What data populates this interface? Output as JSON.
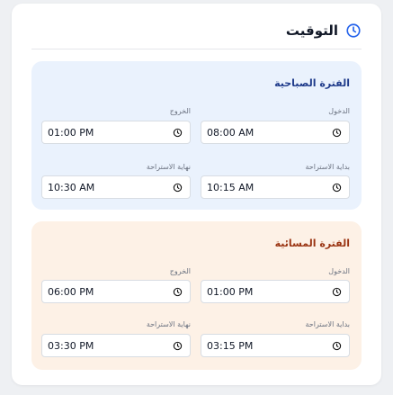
{
  "header": {
    "title": "التوقيت",
    "icon": "clock-icon"
  },
  "colors": {
    "accent": "#2563eb",
    "morning_bg": "#eaf2fd",
    "evening_bg": "#fdf1e6"
  },
  "morning": {
    "title": "الفترة الصباحية",
    "check_in_label": "الدخول",
    "check_in_value": "08:00 AM",
    "check_out_label": "الخروج",
    "check_out_value": "01:00 PM",
    "break_start_label": "بداية الاستراحة",
    "break_start_value": "10:15 AM",
    "break_end_label": "نهاية الاستراحة",
    "break_end_value": "10:30 AM"
  },
  "evening": {
    "title": "الفترة المسائية",
    "check_in_label": "الدخول",
    "check_in_value": "01:00 PM",
    "check_out_label": "الخروج",
    "check_out_value": "06:00 PM",
    "break_start_label": "بداية الاستراحة",
    "break_start_value": "03:15 PM",
    "break_end_label": "نهاية الاستراحة",
    "break_end_value": "03:30 PM"
  }
}
